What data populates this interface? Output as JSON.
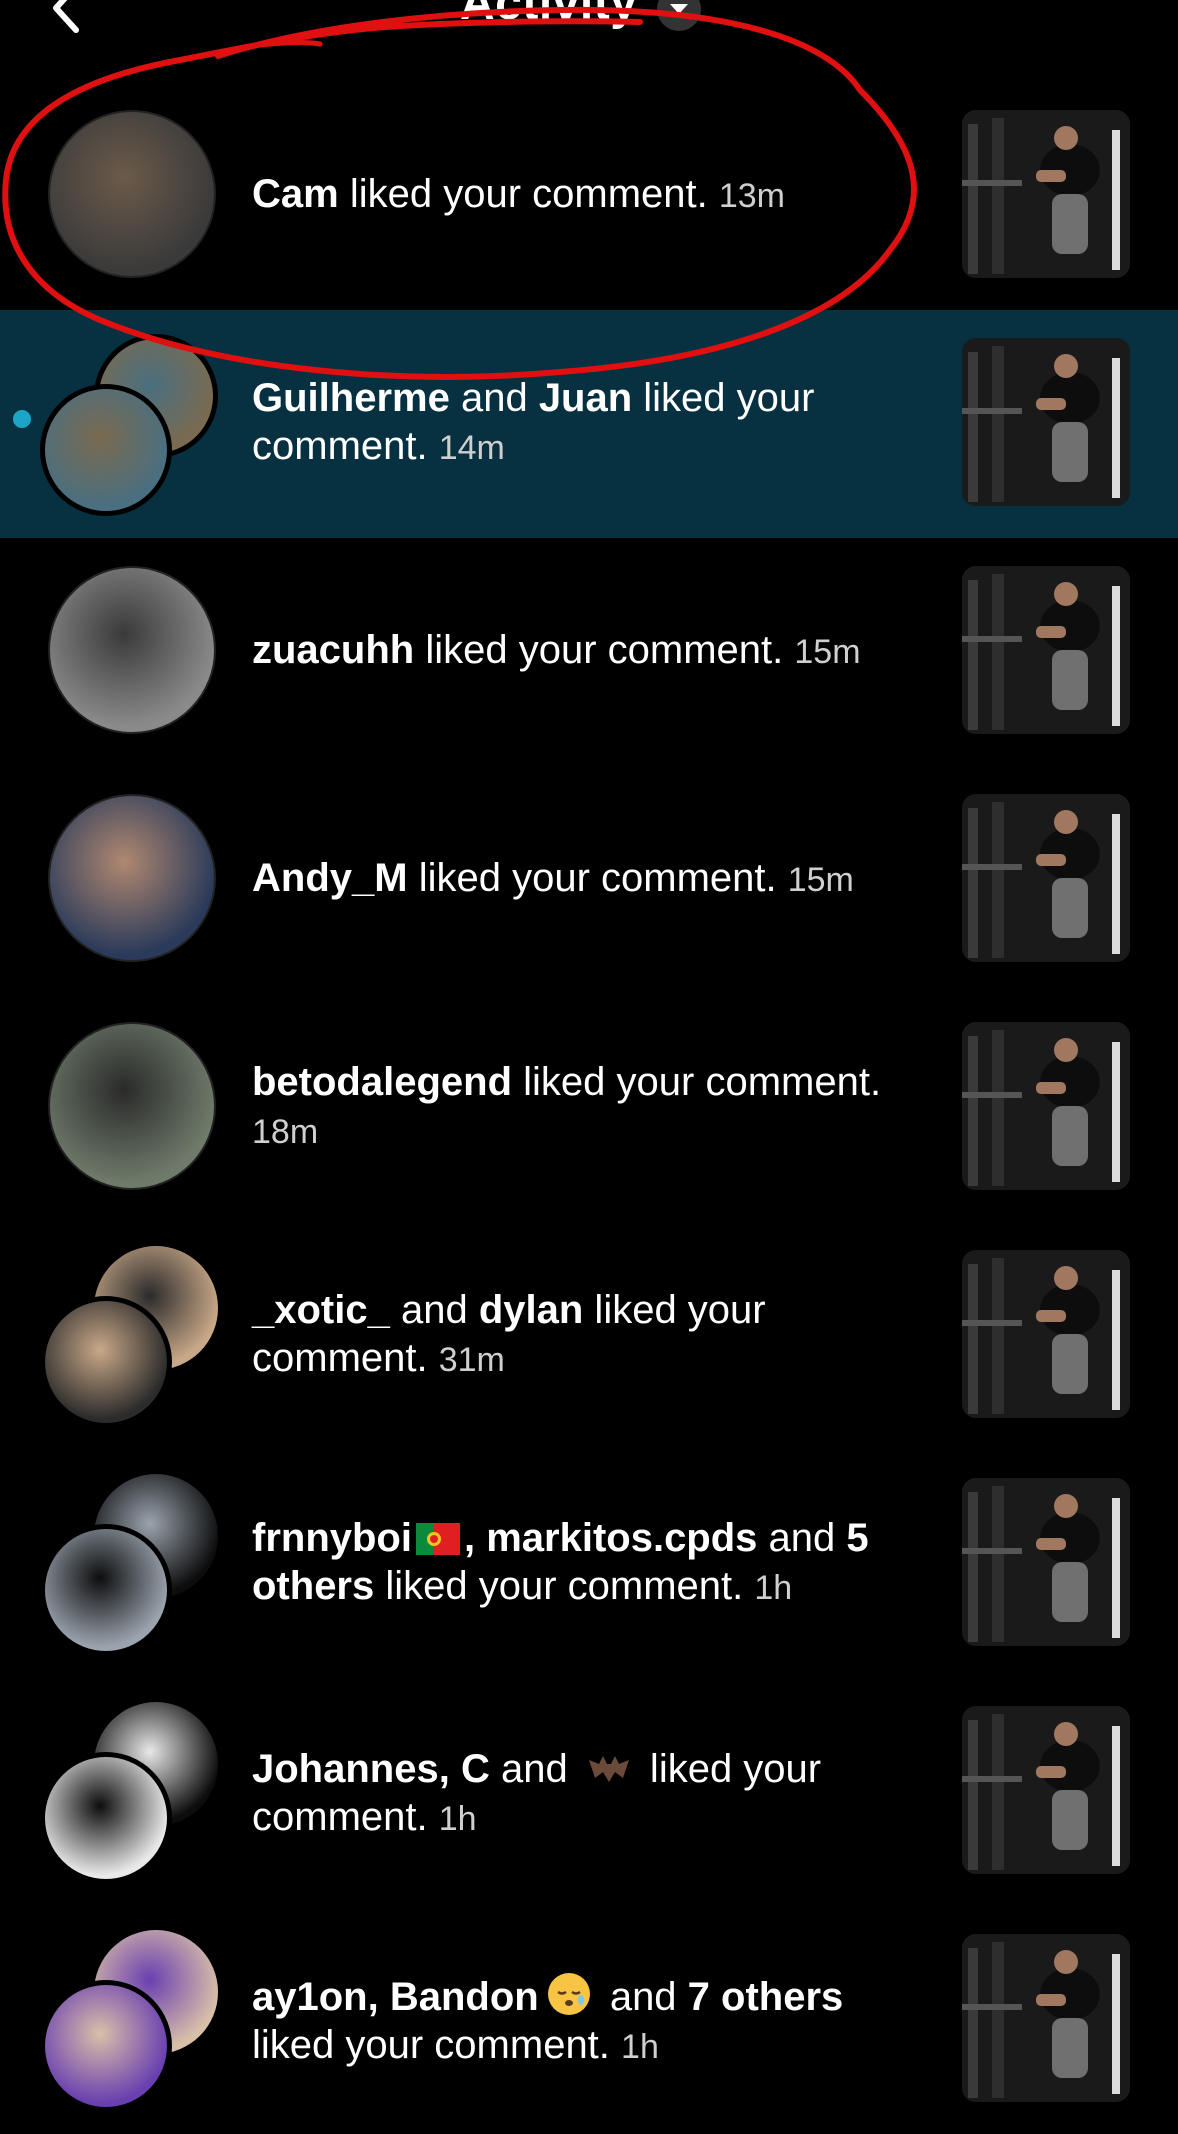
{
  "header": {
    "title": "Activity",
    "back_icon": "chevron-left-icon",
    "dropdown_icon": "caret-down-icon"
  },
  "notifications": [
    {
      "parts": [
        {
          "t": "Cam",
          "b": true
        },
        {
          "t": " liked your comment. ",
          "b": false
        }
      ],
      "time": "13m",
      "unread": false,
      "avatar": "single"
    },
    {
      "parts": [
        {
          "t": "Guilherme",
          "b": true
        },
        {
          "t": " and ",
          "b": false
        },
        {
          "t": "Juan",
          "b": true
        },
        {
          "t": " liked your comment. ",
          "b": false
        }
      ],
      "time": "14m",
      "unread": true,
      "avatar": "double"
    },
    {
      "parts": [
        {
          "t": "zuacuhh",
          "b": true
        },
        {
          "t": " liked your comment. ",
          "b": false
        }
      ],
      "time": "15m",
      "unread": false,
      "avatar": "single"
    },
    {
      "parts": [
        {
          "t": "Andy_M",
          "b": true
        },
        {
          "t": " liked your comment. ",
          "b": false
        }
      ],
      "time": "15m",
      "unread": false,
      "avatar": "single"
    },
    {
      "parts": [
        {
          "t": "betodalegend",
          "b": true
        },
        {
          "t": " liked your comment. ",
          "b": false
        }
      ],
      "time": "18m",
      "unread": false,
      "avatar": "single"
    },
    {
      "parts": [
        {
          "t": "_xotic_",
          "b": true
        },
        {
          "t": " and ",
          "b": false
        },
        {
          "t": "dylan",
          "b": true
        },
        {
          "t": " liked your comment. ",
          "b": false
        }
      ],
      "time": "31m",
      "unread": false,
      "avatar": "double"
    },
    {
      "parts": [
        {
          "t": "frnnyboi",
          "b": true
        },
        {
          "flag": "portugal-flag-emoji"
        },
        {
          "t": ", markitos.cpds",
          "b": true
        },
        {
          "t": " and ",
          "b": false
        },
        {
          "t": "5 others",
          "b": true
        },
        {
          "t": " liked your comment. ",
          "b": false
        }
      ],
      "time": "1h",
      "unread": false,
      "avatar": "double"
    },
    {
      "parts": [
        {
          "t": "Johannes, C",
          "b": true
        },
        {
          "t": " and ",
          "b": false
        },
        {
          "emoji": "bat-emoji"
        },
        {
          "t": " liked your comment. ",
          "b": false
        }
      ],
      "time": "1h",
      "unread": false,
      "avatar": "double"
    },
    {
      "parts": [
        {
          "t": "ay1on, Bandon",
          "b": true
        },
        {
          "emoji": "sleepy-face-emoji"
        },
        {
          "t": " and ",
          "b": false
        },
        {
          "t": "7 others",
          "b": true
        },
        {
          "t": " liked your comment. ",
          "b": false
        }
      ],
      "time": "1h",
      "unread": false,
      "avatar": "double"
    }
  ],
  "colors": {
    "background": "#000000",
    "unread_row": "#073040",
    "unread_dot": "#1aa6c6",
    "annotation": "#e01010"
  }
}
